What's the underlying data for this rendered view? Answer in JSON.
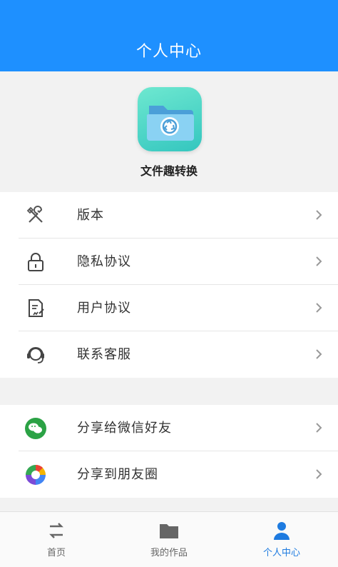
{
  "header": {
    "title": "个人中心"
  },
  "app": {
    "name": "文件趣转换",
    "icon": "folder-recycle-icon"
  },
  "menu_group_1": [
    {
      "label": "版本",
      "icon": "tools-icon"
    },
    {
      "label": "隐私协议",
      "icon": "lock-icon"
    },
    {
      "label": "用户协议",
      "icon": "document-edit-icon"
    },
    {
      "label": "联系客服",
      "icon": "headset-icon"
    }
  ],
  "menu_group_2": [
    {
      "label": "分享给微信好友",
      "icon": "wechat-icon"
    },
    {
      "label": "分享到朋友圈",
      "icon": "moments-icon"
    }
  ],
  "tabbar": {
    "items": [
      {
        "label": "首页",
        "icon": "swap-arrows-icon",
        "active": false
      },
      {
        "label": "我的作品",
        "icon": "folder-icon",
        "active": false
      },
      {
        "label": "个人中心",
        "icon": "user-icon",
        "active": true
      }
    ]
  },
  "colors": {
    "header_bg": "#1e90ff",
    "active_tab": "#1e7be0",
    "wechat_green": "#2ba245",
    "app_icon_teal": "#34c6bf"
  }
}
